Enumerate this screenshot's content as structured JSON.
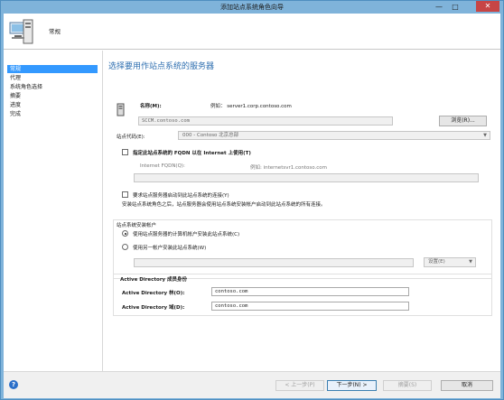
{
  "window": {
    "title": "添加站点系统角色向导",
    "minimize": "—",
    "maximize": "□",
    "close": "✕"
  },
  "header": {
    "title": "常规",
    "icon": "server-icon"
  },
  "nav": {
    "items": [
      {
        "label": "常规",
        "active": true
      },
      {
        "label": "代理",
        "active": false
      },
      {
        "label": "系统角色选择",
        "active": false
      },
      {
        "label": "摘要",
        "active": false
      },
      {
        "label": "进度",
        "active": false
      },
      {
        "label": "完成",
        "active": false
      }
    ]
  },
  "main": {
    "title": "选择要用作站点系统的服务器",
    "name_label": "名称(M):",
    "name_example": "例如：  server1.corp.contoso.com",
    "name_value": "SCCM.contoso.com",
    "browse_label": "浏览(R)...",
    "site_code_label": "站点代码(E):",
    "site_code_value": "000 - Contoso 北京总部",
    "fqdn_checkbox_label": "指定此站点系统的 FQDN 以在 Internet 上使用(T)",
    "fqdn_label": "Internet FQDN(Q):",
    "fqdn_example": "例如:  internetsvr1.contoso.com",
    "fqdn_value": "",
    "require_connection_label": "要求站点服务器启动到此站点系统的连接(Y)",
    "require_connection_note": "安装站点系统角色之后，站点服务器会使用站点系统安装帐户启动到此站点系统的所有连接。",
    "install_account_group": "站点系统安装帐户",
    "radio_computer_account": "使用站点服务器的计算机帐户安装此站点系统(C)",
    "radio_other_account": "使用另一帐户安装此站点系统(W)",
    "other_account_value": "",
    "settings_button": "设置(E)",
    "ad_group": "Active Directory 成员身份",
    "ad_forest_label": "Active Directory 林(O):",
    "ad_forest_value": "contoso.com",
    "ad_domain_label": "Active Directory 域(D):",
    "ad_domain_value": "contoso.com"
  },
  "footer": {
    "help": "?",
    "prev": "< 上一步(P)",
    "next": "下一步(N) >",
    "summary": "摘要(S)",
    "cancel": "取消"
  }
}
